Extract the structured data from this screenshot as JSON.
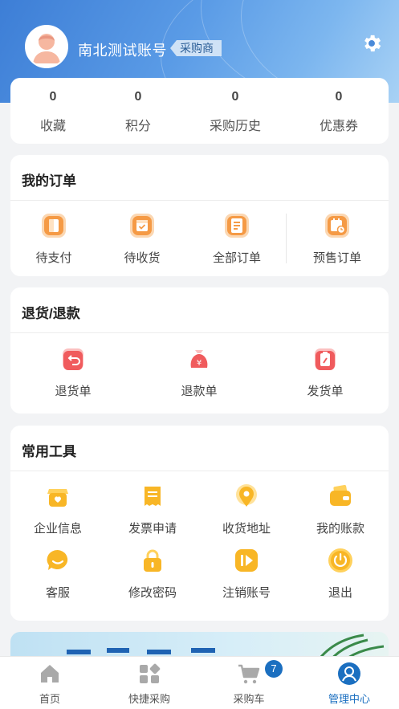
{
  "header": {
    "username": "南北测试账号",
    "role_badge": "采购商",
    "settings_icon": "gear-icon",
    "avatar_icon": "user-avatar"
  },
  "stats": [
    {
      "value": "0",
      "label": "收藏"
    },
    {
      "value": "0",
      "label": "积分"
    },
    {
      "value": "0",
      "label": "采购历史"
    },
    {
      "value": "0",
      "label": "优惠券"
    }
  ],
  "orders": {
    "title": "我的订单",
    "items": [
      {
        "label": "待支付",
        "icon": "wallet-icon"
      },
      {
        "label": "待收货",
        "icon": "receive-box-icon"
      },
      {
        "label": "全部订单",
        "icon": "order-list-icon"
      },
      {
        "label": "预售订单",
        "icon": "presale-calendar-icon"
      }
    ]
  },
  "returns": {
    "title": "退货/退款",
    "items": [
      {
        "label": "退货单",
        "icon": "return-icon"
      },
      {
        "label": "退款单",
        "icon": "refund-bag-icon"
      },
      {
        "label": "发货单",
        "icon": "ship-clipboard-icon"
      }
    ]
  },
  "tools": {
    "title": "常用工具",
    "items": [
      {
        "label": "企业信息",
        "icon": "shop-heart-icon"
      },
      {
        "label": "发票申请",
        "icon": "invoice-icon"
      },
      {
        "label": "收货地址",
        "icon": "location-pin-icon"
      },
      {
        "label": "我的账款",
        "icon": "wallet-card-icon"
      },
      {
        "label": "客服",
        "icon": "chat-smile-icon"
      },
      {
        "label": "修改密码",
        "icon": "lock-icon"
      },
      {
        "label": "注销账号",
        "icon": "deregister-icon"
      },
      {
        "label": "退出",
        "icon": "power-icon"
      }
    ]
  },
  "tabbar": {
    "items": [
      {
        "label": "首页",
        "icon": "home-icon"
      },
      {
        "label": "快捷采购",
        "icon": "grid-apps-icon"
      },
      {
        "label": "采购车",
        "icon": "cart-icon",
        "badge": "7"
      },
      {
        "label": "管理中心",
        "icon": "profile-circle-icon"
      }
    ],
    "active_color": "#1b6fc0"
  },
  "colors": {
    "header_gradient_start": "#3d7ed6",
    "orange_icon": "#f7a14a",
    "red_icon": "#f0575a",
    "yellow_icon": "#f8c12e",
    "accent": "#1b6fc0"
  }
}
